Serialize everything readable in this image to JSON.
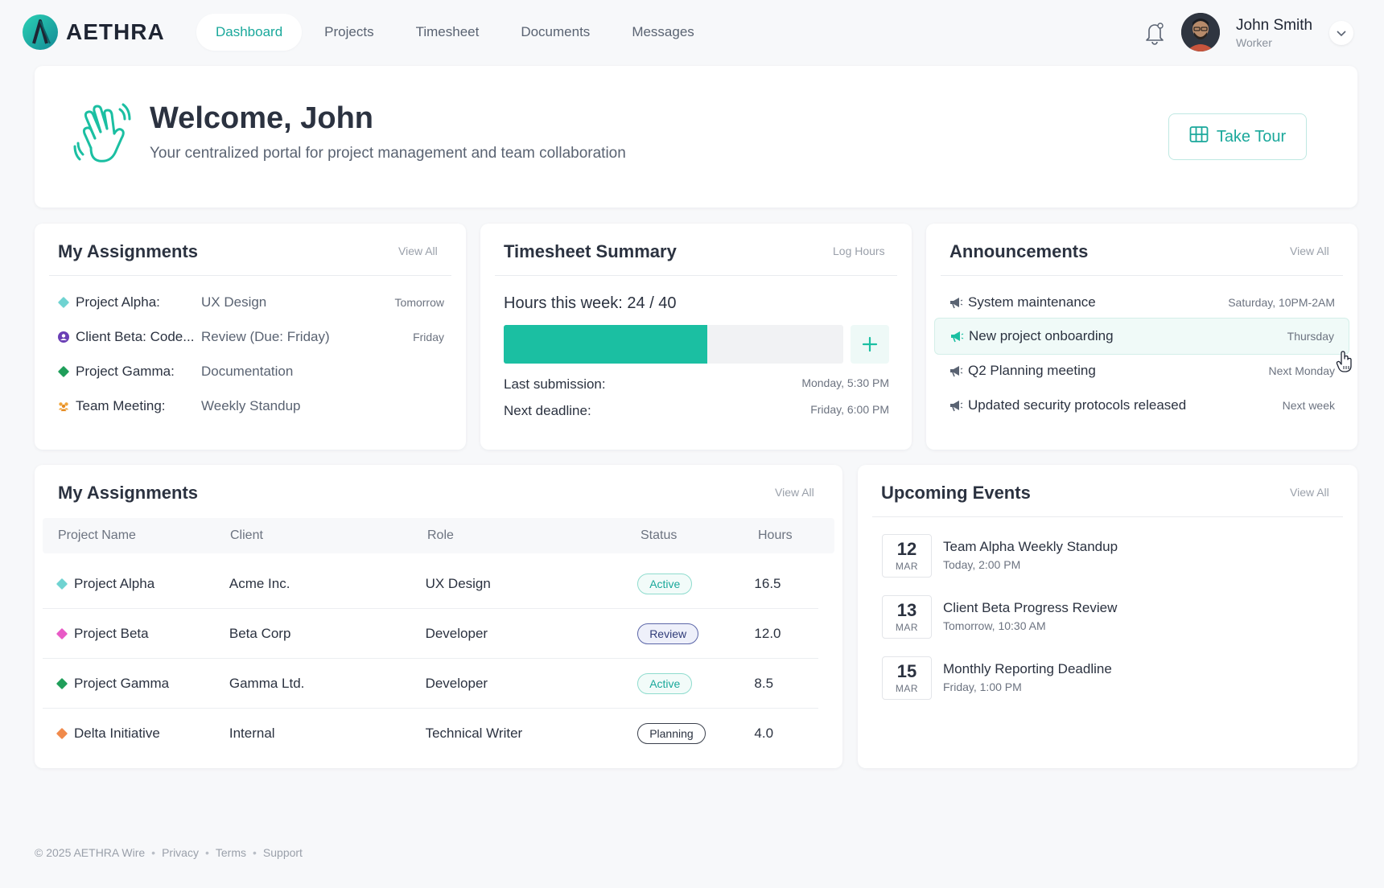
{
  "brand": {
    "name": "AETHRA",
    "accent": "#1aa89b"
  },
  "nav": [
    {
      "label": "Dashboard",
      "active": true
    },
    {
      "label": "Projects",
      "active": false
    },
    {
      "label": "Timesheet",
      "active": false
    },
    {
      "label": "Documents",
      "active": false
    },
    {
      "label": "Messages",
      "active": false
    }
  ],
  "user": {
    "name": "John Smith",
    "role": "Worker"
  },
  "icons": {
    "notifications": "bell-icon",
    "dropdown": "chevron-down-icon",
    "welcome": "waving-hand-icon",
    "tour": "map-icon",
    "announcement": "megaphone-icon",
    "add": "plus-icon"
  },
  "welcome": {
    "title": "Welcome, John",
    "subtitle": "Your centralized portal for project management and team collaboration",
    "tour_label": "Take Tour"
  },
  "assignments_card": {
    "title": "My Assignments",
    "link": "View All",
    "items": [
      {
        "name": "Project Alpha:",
        "task": "UX Design",
        "when": "Tomorrow",
        "bullet": "diamond",
        "color": "#6fd3d1"
      },
      {
        "name": "Client Beta: Code...",
        "task": "Review (Due: Friday)",
        "when": "Friday",
        "bullet": "person",
        "color": "#6a3fb5"
      },
      {
        "name": "Project Gamma:",
        "task": "Documentation",
        "when": "",
        "bullet": "diamond",
        "color": "#1f9e5a"
      },
      {
        "name": "Team Meeting:",
        "task": "Weekly Standup",
        "when": "",
        "bullet": "team",
        "color": "#f0a43a"
      }
    ]
  },
  "timesheet_card": {
    "title": "Timesheet Summary",
    "link": "Log Hours",
    "hours_label": "Hours this week: 24 / 40",
    "hours_logged": 24,
    "hours_target": 40,
    "last_submission_label": "Last submission:",
    "last_submission_value": "Monday, 5:30 PM",
    "next_deadline_label": "Next deadline:",
    "next_deadline_value": "Friday, 6:00 PM"
  },
  "announcements_card": {
    "title": "Announcements",
    "link": "View All",
    "items": [
      {
        "text": "System maintenance",
        "when": "Saturday, 10PM-2AM",
        "highlight": false
      },
      {
        "text": "New project onboarding",
        "when": "Thursday",
        "highlight": true
      },
      {
        "text": "Q2 Planning meeting",
        "when": "Next Monday",
        "highlight": false
      },
      {
        "text": "Updated security protocols released",
        "when": "Next week",
        "highlight": false
      }
    ]
  },
  "assignments_table": {
    "title": "My Assignments",
    "link": "View All",
    "columns": [
      "Project Name",
      "Client",
      "Role",
      "Status",
      "Hours"
    ],
    "rows": [
      {
        "project": "Project Alpha",
        "client": "Acme Inc.",
        "role": "UX Design",
        "status": "Active",
        "status_kind": "active",
        "hours": "16.5",
        "color": "#6fd3d1"
      },
      {
        "project": "Project Beta",
        "client": "Beta Corp",
        "role": "Developer",
        "status": "Review",
        "status_kind": "review",
        "hours": "12.0",
        "color": "#e85ac6"
      },
      {
        "project": "Project Gamma",
        "client": "Gamma Ltd.",
        "role": "Developer",
        "status": "Active",
        "status_kind": "active",
        "hours": "8.5",
        "color": "#1f9e5a"
      },
      {
        "project": "Delta Initiative",
        "client": "Internal",
        "role": "Technical Writer",
        "status": "Planning",
        "status_kind": "planning",
        "hours": "4.0",
        "color": "#f08a4b"
      }
    ]
  },
  "events_card": {
    "title": "Upcoming Events",
    "link": "View All",
    "items": [
      {
        "day": "12",
        "month": "MAR",
        "title": "Team Alpha Weekly Standup",
        "time": "Today, 2:00 PM"
      },
      {
        "day": "13",
        "month": "MAR",
        "title": "Client Beta Progress Review",
        "time": "Tomorrow, 10:30 AM"
      },
      {
        "day": "15",
        "month": "MAR",
        "title": "Monthly Reporting Deadline",
        "time": "Friday, 1:00 PM"
      }
    ]
  },
  "footer": {
    "copyright": "© 2025 AETHRA Wire",
    "links": [
      "Privacy",
      "Terms",
      "Support"
    ]
  }
}
